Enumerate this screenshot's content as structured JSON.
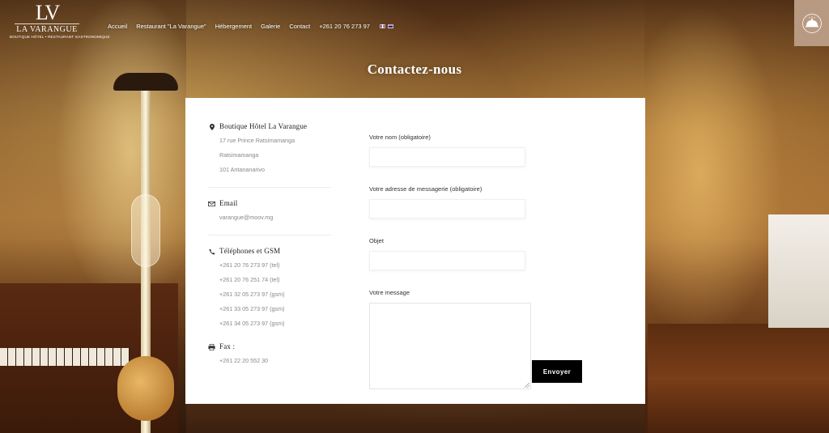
{
  "logo": {
    "mark": "LV",
    "name": "LA VARANGUE",
    "tagline": "BOUTIQUE HÔTEL • RESTAURANT GASTRONOMIQUE"
  },
  "nav": {
    "items": [
      {
        "label": "Accueil"
      },
      {
        "label": "Restaurant \"La Varangue\""
      },
      {
        "label": "Hébergement"
      },
      {
        "label": "Galerie"
      },
      {
        "label": "Contact"
      },
      {
        "label": "+261 20 76 273 97"
      }
    ],
    "flags": [
      "fr-flag-icon",
      "en-flag-icon"
    ]
  },
  "page_title": "Contactez-nous",
  "contact": {
    "address": {
      "title": "Boutique Hôtel La Varangue",
      "lines": [
        "17 rue Prince Ratsimamanga",
        "Ratsimamanga",
        "101 Antananarivo"
      ]
    },
    "email": {
      "title": "Email",
      "value": "varangue@moov.mg"
    },
    "phones": {
      "title": "Téléphones et GSM",
      "lines": [
        "+261 20 76 273 97 (tel)",
        "+261 20 76 251 74 (tel)",
        "+261 32 05 273 97 (gsm)",
        "+261 33 05 273 97 (gsm)",
        "+261 34 05 273 97 (gsm)"
      ]
    },
    "fax": {
      "title": "Fax :",
      "value": "+261 22 20 552 30"
    }
  },
  "form": {
    "name_label": "Votre nom (obligatoire)",
    "email_label": "Votre adresse de messagerie (obligatoire)",
    "subject_label": "Objet",
    "message_label": "Votre message",
    "submit_label": "Envoyer"
  },
  "colors": {
    "card_bg": "#ffffff",
    "button_bg": "#000000",
    "cloche_box": "#b89a82"
  }
}
